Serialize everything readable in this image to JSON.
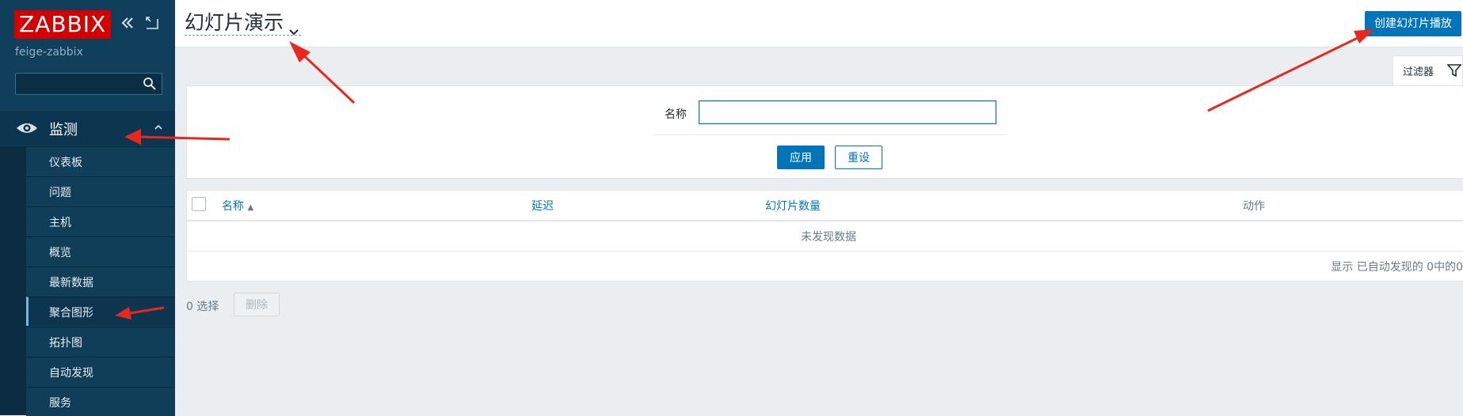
{
  "sidebar": {
    "logo_text": "ZABBIX",
    "server_name": "feige-zabbix",
    "search_placeholder": "",
    "section": {
      "label": "监测",
      "icon": "eye-icon"
    },
    "items": [
      {
        "label": "仪表板",
        "active": false
      },
      {
        "label": "问题",
        "active": false
      },
      {
        "label": "主机",
        "active": false
      },
      {
        "label": "概览",
        "active": false
      },
      {
        "label": "最新数据",
        "active": false
      },
      {
        "label": "聚合图形",
        "active": true
      },
      {
        "label": "拓扑图",
        "active": false
      },
      {
        "label": "自动发现",
        "active": false
      },
      {
        "label": "服务",
        "active": false
      }
    ]
  },
  "header": {
    "title": "幻灯片演示",
    "create_button": "创建幻灯片播放"
  },
  "filter": {
    "tab_label": "过滤器",
    "name_label": "名称",
    "name_value": "",
    "apply_label": "应用",
    "reset_label": "重设"
  },
  "table": {
    "columns": {
      "name": "名称",
      "delay": "延迟",
      "slide_count": "幻灯片数量",
      "actions": "动作"
    },
    "sort_indicator": "▲",
    "empty_message": "未发现数据",
    "footer": "显示 已自动发现的 0中的0"
  },
  "bulk": {
    "selected_text": "0 选择",
    "delete_label": "删除"
  },
  "colors": {
    "sidebar": "#0f3f5b",
    "accent": "#0275b8",
    "logo": "#d40000",
    "annotation_arrow": "#e8281e"
  }
}
